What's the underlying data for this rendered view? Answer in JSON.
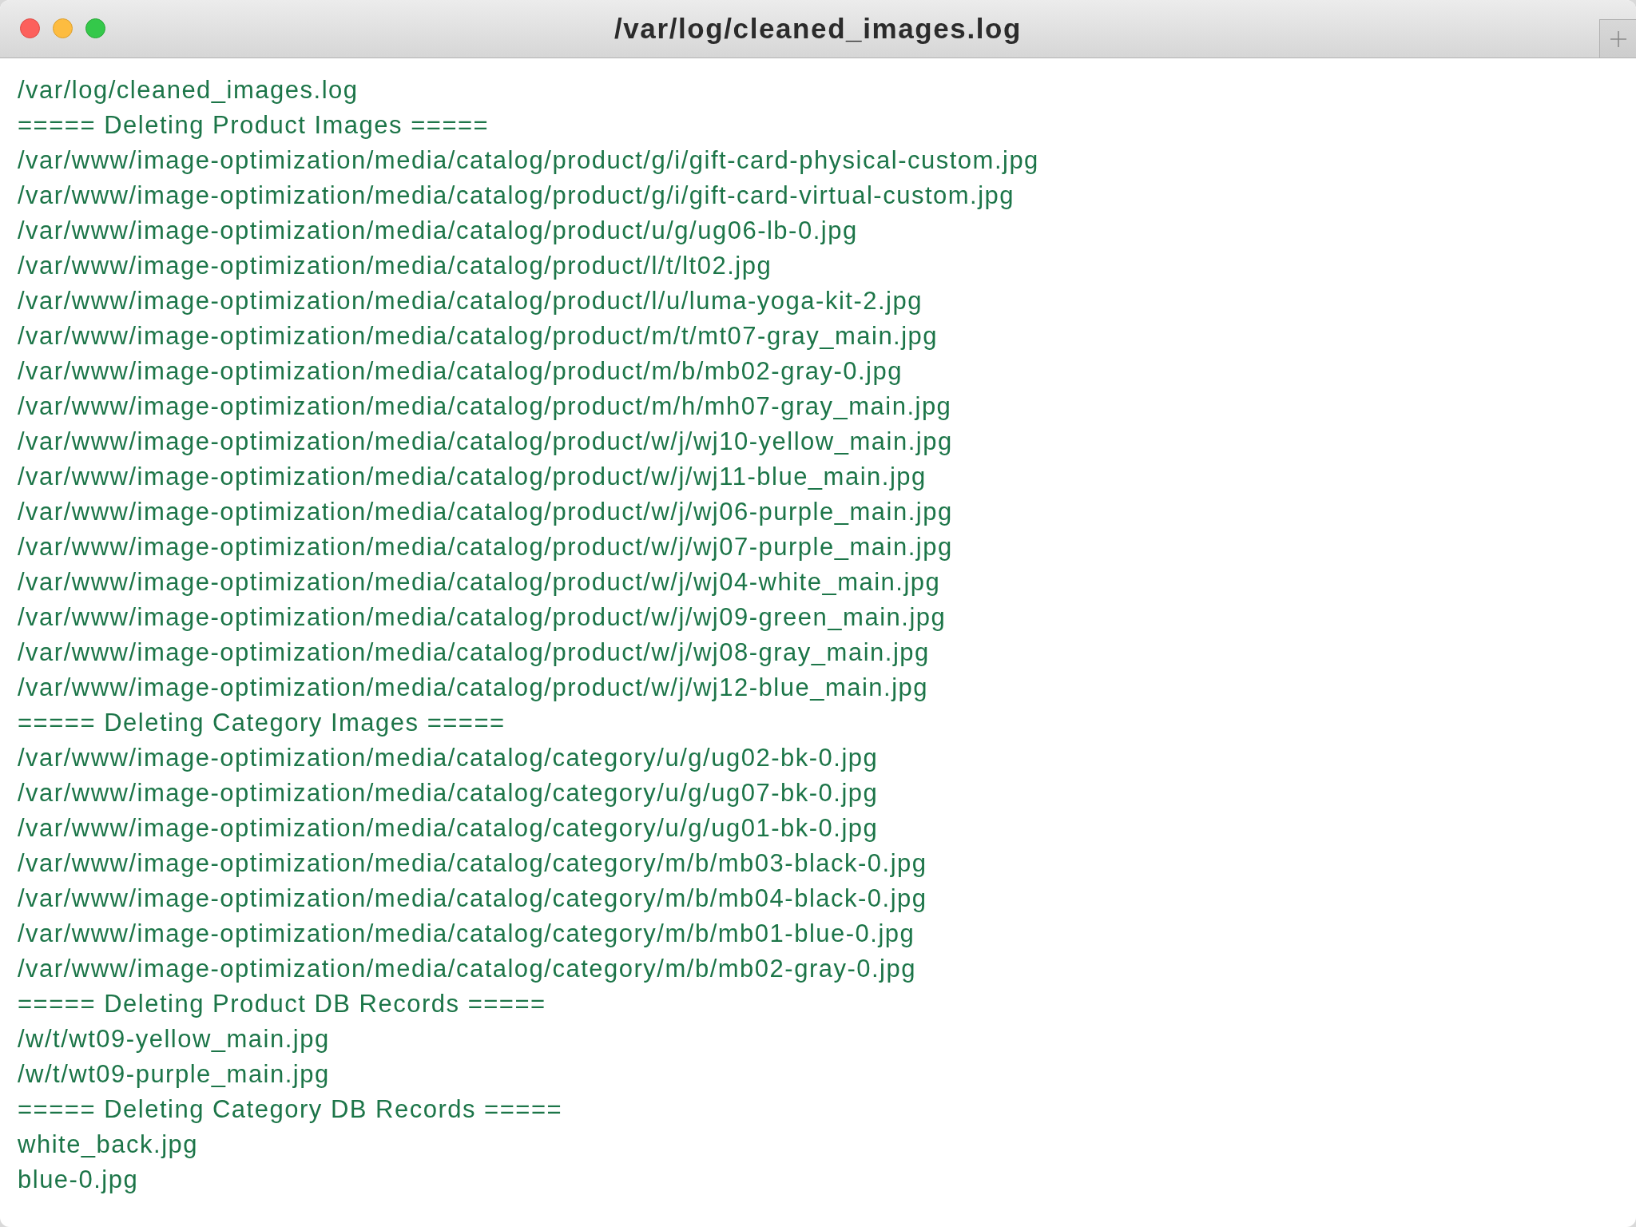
{
  "window": {
    "title": "/var/log/cleaned_images.log"
  },
  "log": {
    "lines": [
      "/var/log/cleaned_images.log",
      "===== Deleting Product Images =====",
      "/var/www/image-optimization/media/catalog/product/g/i/gift-card-physical-custom.jpg",
      "/var/www/image-optimization/media/catalog/product/g/i/gift-card-virtual-custom.jpg",
      "/var/www/image-optimization/media/catalog/product/u/g/ug06-lb-0.jpg",
      "/var/www/image-optimization/media/catalog/product/l/t/lt02.jpg",
      "/var/www/image-optimization/media/catalog/product/l/u/luma-yoga-kit-2.jpg",
      "/var/www/image-optimization/media/catalog/product/m/t/mt07-gray_main.jpg",
      "/var/www/image-optimization/media/catalog/product/m/b/mb02-gray-0.jpg",
      "/var/www/image-optimization/media/catalog/product/m/h/mh07-gray_main.jpg",
      "/var/www/image-optimization/media/catalog/product/w/j/wj10-yellow_main.jpg",
      "/var/www/image-optimization/media/catalog/product/w/j/wj11-blue_main.jpg",
      "/var/www/image-optimization/media/catalog/product/w/j/wj06-purple_main.jpg",
      "/var/www/image-optimization/media/catalog/product/w/j/wj07-purple_main.jpg",
      "/var/www/image-optimization/media/catalog/product/w/j/wj04-white_main.jpg",
      "/var/www/image-optimization/media/catalog/product/w/j/wj09-green_main.jpg",
      "/var/www/image-optimization/media/catalog/product/w/j/wj08-gray_main.jpg",
      "/var/www/image-optimization/media/catalog/product/w/j/wj12-blue_main.jpg",
      "===== Deleting Category Images =====",
      "/var/www/image-optimization/media/catalog/category/u/g/ug02-bk-0.jpg",
      "/var/www/image-optimization/media/catalog/category/u/g/ug07-bk-0.jpg",
      "/var/www/image-optimization/media/catalog/category/u/g/ug01-bk-0.jpg",
      "/var/www/image-optimization/media/catalog/category/m/b/mb03-black-0.jpg",
      "/var/www/image-optimization/media/catalog/category/m/b/mb04-black-0.jpg",
      "/var/www/image-optimization/media/catalog/category/m/b/mb01-blue-0.jpg",
      "/var/www/image-optimization/media/catalog/category/m/b/mb02-gray-0.jpg",
      "===== Deleting Product DB Records =====",
      "/w/t/wt09-yellow_main.jpg",
      "/w/t/wt09-purple_main.jpg",
      "===== Deleting Category DB Records =====",
      "white_back.jpg",
      "blue-0.jpg"
    ]
  }
}
